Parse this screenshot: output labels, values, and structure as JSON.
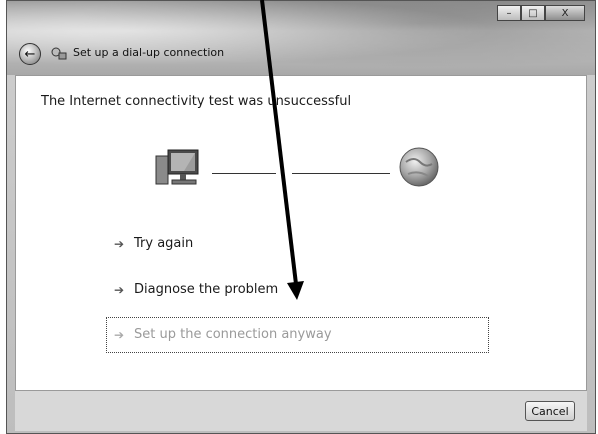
{
  "window": {
    "title": "Set up a dial-up connection",
    "controls": {
      "minimize": "–",
      "maximize": "□",
      "close": "X"
    },
    "back_glyph": "←"
  },
  "content": {
    "heading": "The Internet connectivity test was unsuccessful",
    "commands": [
      {
        "label": "Try again",
        "enabled": true
      },
      {
        "label": "Diagnose the problem",
        "enabled": true
      },
      {
        "label": "Set up the connection anyway",
        "enabled": false
      }
    ],
    "icons": {
      "computer": "computer-icon",
      "internet": "globe-icon",
      "command_arrow": "arrow-right-icon"
    }
  },
  "footer": {
    "cancel_label": "Cancel"
  }
}
